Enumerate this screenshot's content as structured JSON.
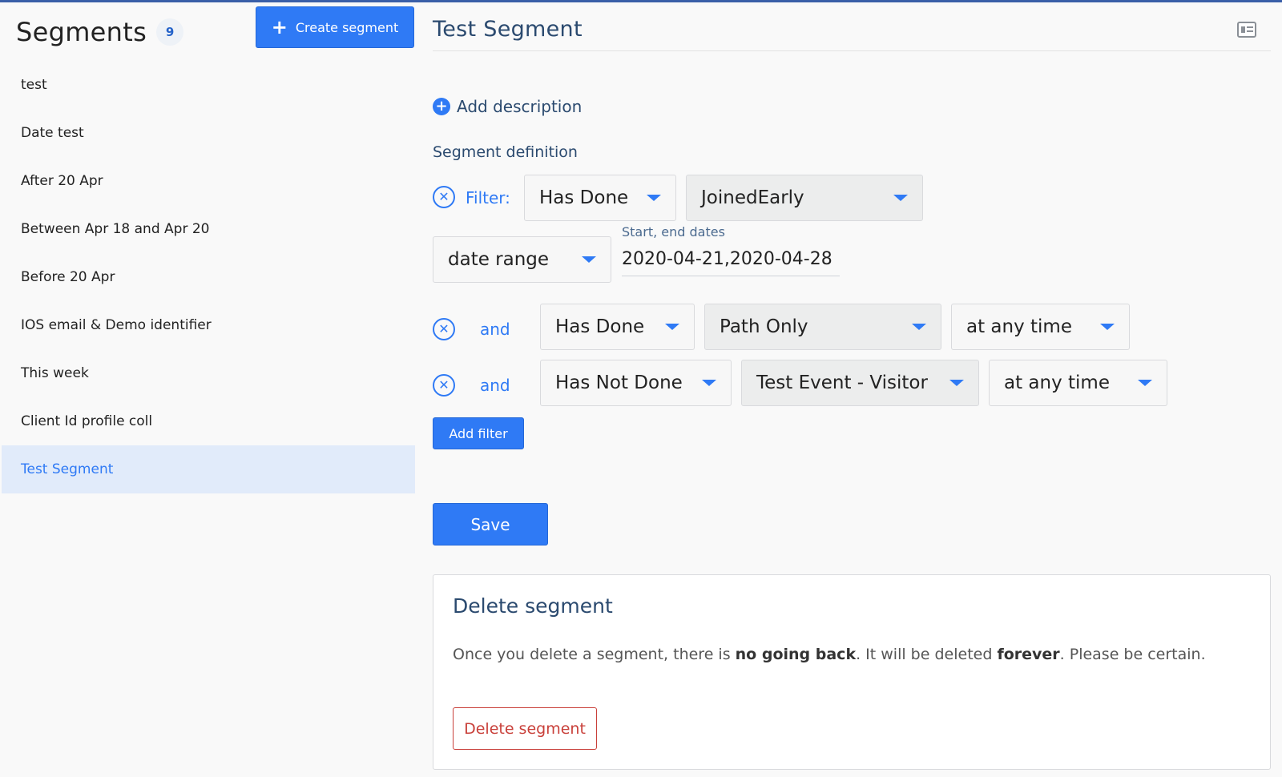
{
  "sidebar": {
    "title": "Segments",
    "count": "9",
    "create_label": "Create segment",
    "items": [
      {
        "label": "test"
      },
      {
        "label": "Date test"
      },
      {
        "label": "After 20 Apr"
      },
      {
        "label": "Between Apr 18 and Apr 20"
      },
      {
        "label": "Before 20 Apr"
      },
      {
        "label": "IOS email & Demo identifier"
      },
      {
        "label": "This week"
      },
      {
        "label": "Client Id profile coll"
      },
      {
        "label": "Test Segment",
        "active": true
      }
    ]
  },
  "main": {
    "title": "Test Segment",
    "add_description": "Add description",
    "segment_definition": "Segment definition",
    "filters": [
      {
        "op": "Filter:",
        "action": "Has Done",
        "event": "JoinedEarly",
        "time": "date range",
        "date_label": "Start, end dates",
        "date_value": "2020-04-21,2020-04-28"
      },
      {
        "op": "and",
        "action": "Has Done",
        "event": "Path Only",
        "time": "at any time"
      },
      {
        "op": "and",
        "action": "Has Not Done",
        "event": "Test Event - Visitor",
        "time": "at any time"
      }
    ],
    "add_filter_label": "Add filter",
    "save_label": "Save",
    "delete": {
      "title": "Delete segment",
      "text_before": "Once you delete a segment, there is ",
      "text_bold1": "no going back",
      "text_middle": ". It will be deleted ",
      "text_bold2": "forever",
      "text_after": ". Please be certain.",
      "button_label": "Delete segment"
    }
  },
  "icons": {
    "plus": "plus-icon",
    "plus_circle": "plus-circle-icon",
    "remove": "x-circle-icon",
    "caret": "caret-down-icon",
    "card": "id-card-icon"
  },
  "colors": {
    "accent": "#2f7af5",
    "heading": "#2b4a6f",
    "danger": "#c9403a",
    "active_bg": "#e1ebfa"
  }
}
